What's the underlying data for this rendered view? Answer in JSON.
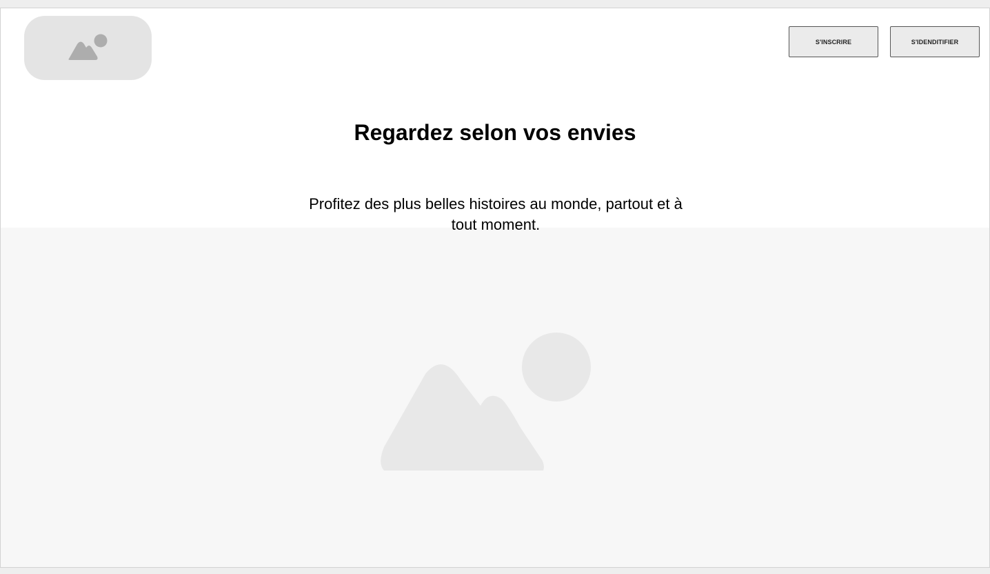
{
  "header": {
    "logo_icon": "image-placeholder-icon",
    "signup_label": "S'INSCRIRE",
    "login_label": "S'IDENDITIFIER"
  },
  "hero": {
    "title": "Regardez selon vos envies",
    "subtitle": "Profitez des plus belles histoires au monde, partout et à tout moment.",
    "image_icon": "image-placeholder-icon"
  },
  "colors": {
    "page_background": "#eeeeee",
    "frame_background": "#ffffff",
    "placeholder_fill": "#e4e4e4",
    "placeholder_icon": "#adadad",
    "hero_background": "#f7f7f7",
    "hero_icon": "#e8e8e8",
    "button_background": "#ebebeb",
    "button_border": "#555555"
  }
}
